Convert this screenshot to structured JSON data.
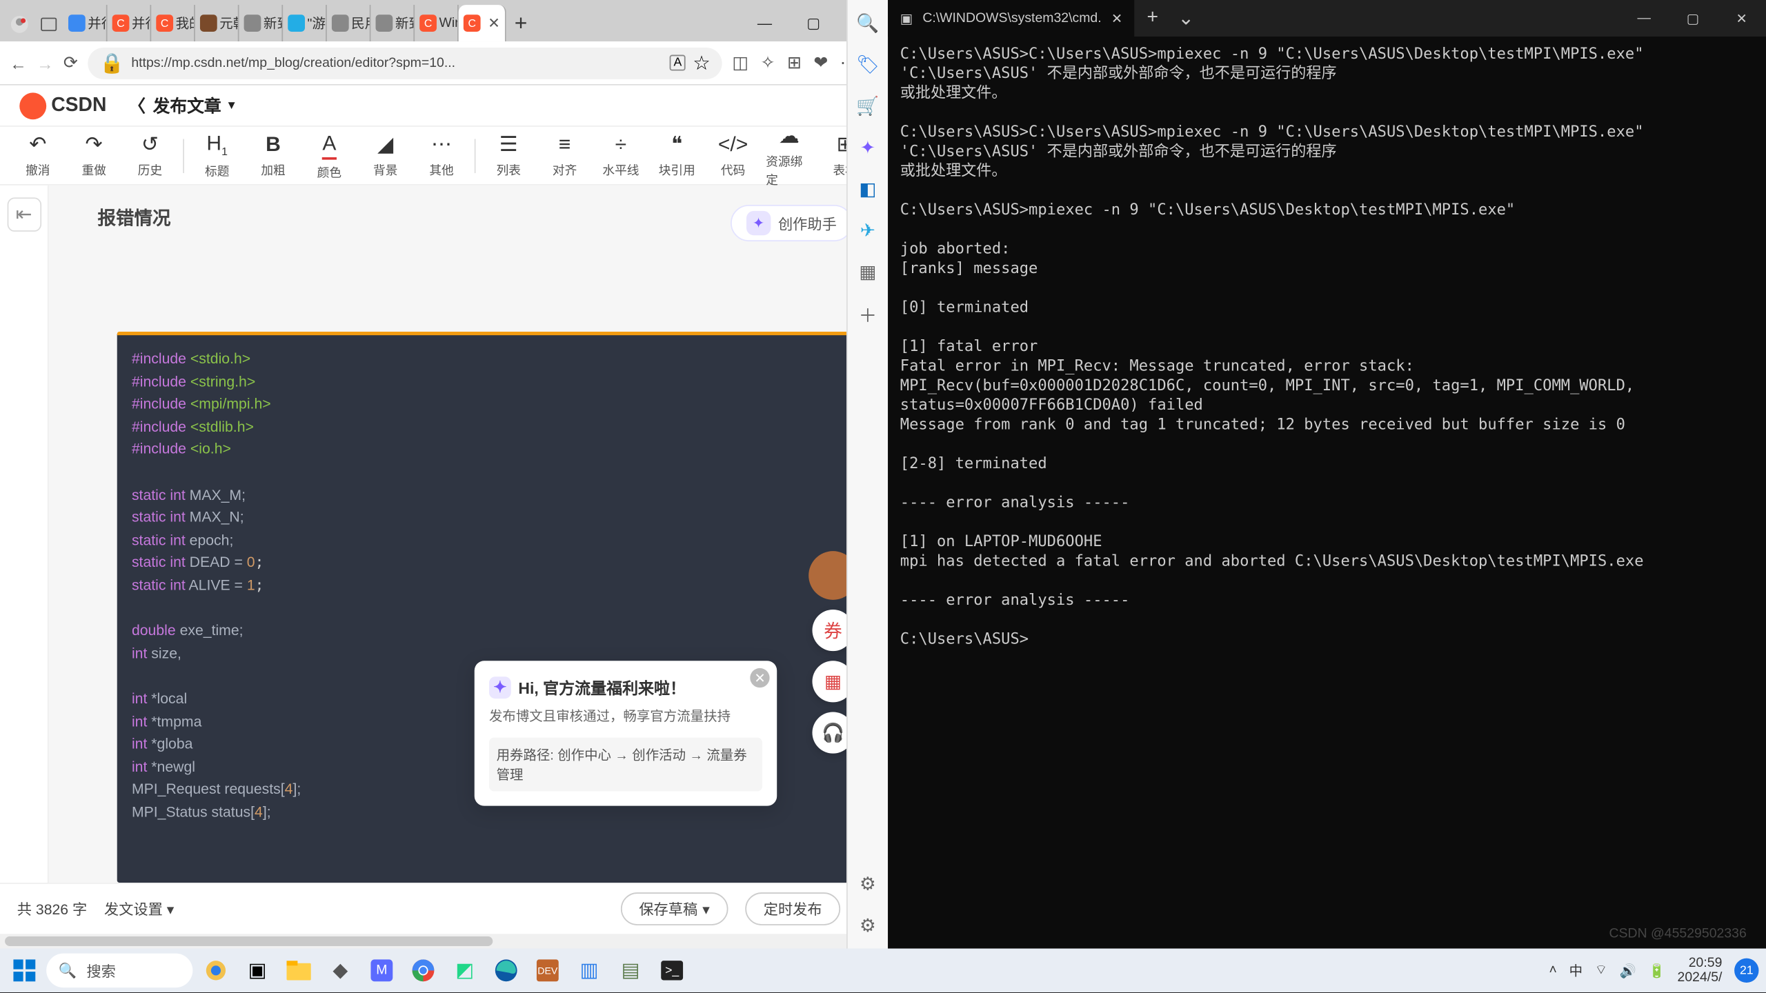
{
  "browser": {
    "tabs": [
      {
        "icon": "q",
        "label": "并行"
      },
      {
        "icon": "c",
        "label": "并行"
      },
      {
        "icon": "c",
        "label": "我的"
      },
      {
        "icon": "bear",
        "label": "元朝"
      },
      {
        "icon": "page",
        "label": "新到"
      },
      {
        "icon": "bili",
        "label": "\"游"
      },
      {
        "icon": "page",
        "label": "民用"
      },
      {
        "icon": "page",
        "label": "新到"
      },
      {
        "icon": "c",
        "label": "Wir"
      },
      {
        "icon": "c",
        "label": "",
        "active": true
      }
    ],
    "addr": "https://mp.csdn.net/mp_blog/creation/editor?spm=10...",
    "addr_tech": "A",
    "csdn": {
      "logo": "CSDN",
      "title": "发布文章"
    },
    "toolbar": {
      "undo": "撤消",
      "redo": "重做",
      "history": "历史",
      "h": "标题",
      "b": "加粗",
      "color": "颜色",
      "bg": "背景",
      "other": "其他",
      "list": "列表",
      "align": "对齐",
      "hr": "水平线",
      "quote": "块引用",
      "code": "代码",
      "res": "资源绑定",
      "table": "表格"
    },
    "section_heading": "报错情况",
    "assist": "创作助手",
    "popup": {
      "title": "Hi, 官方流量福利来啦！",
      "sub": "发布博文且审核通过，畅享官方流量扶持",
      "path_label": "用券路径:",
      "p1": "创作中心",
      "p2": "创作活动",
      "p3": "流量券管理"
    },
    "footer": {
      "count_prefix": "共",
      "count": "3826",
      "count_suffix": "字",
      "settings": "发文设置",
      "draft": "保存草稿",
      "schedule": "定时发布"
    },
    "code_lines": [
      {
        "t": "inc",
        "h": "#include ",
        "v": "<stdio.h>"
      },
      {
        "t": "inc",
        "h": "#include ",
        "v": "<string.h>"
      },
      {
        "t": "inc",
        "h": "#include ",
        "v": "<mpi/mpi.h>"
      },
      {
        "t": "inc",
        "h": "#include ",
        "v": "<stdlib.h>"
      },
      {
        "t": "inc",
        "h": "#include ",
        "v": "<io.h>"
      },
      {
        "t": "blank"
      },
      {
        "t": "decl",
        "k": "static int",
        "n": " MAX_M;"
      },
      {
        "t": "decl",
        "k": "static int",
        "n": " MAX_N;"
      },
      {
        "t": "decl",
        "k": "static int",
        "n": " epoch;"
      },
      {
        "t": "decl",
        "k": "static int",
        "n": " DEAD = ",
        "num": "0",
        "tail": ";"
      },
      {
        "t": "decl",
        "k": "static int",
        "n": " ALIVE = ",
        "num": "1",
        "tail": ";"
      },
      {
        "t": "blank"
      },
      {
        "t": "decl",
        "k": "double",
        "n": " exe_time;"
      },
      {
        "t": "decl",
        "k": "int",
        "n": " size,"
      },
      {
        "t": "blank"
      },
      {
        "t": "decl",
        "k": "int",
        "n": " *local"
      },
      {
        "t": "decl",
        "k": "int",
        "n": " *tmpma"
      },
      {
        "t": "decl",
        "k": "int",
        "n": " *globa"
      },
      {
        "t": "decl",
        "k": "int",
        "n": " *newgl"
      },
      {
        "t": "plain",
        "v": "MPI_Request requests[",
        "num": "4",
        "tail": "];"
      },
      {
        "t": "plain",
        "v": "MPI_Status status[",
        "num": "4",
        "tail": "];"
      }
    ]
  },
  "side_icons": [
    "search",
    "tag",
    "cart",
    "copilot",
    "outlook",
    "send",
    "grid",
    "plus",
    "tool",
    "gear"
  ],
  "terminal": {
    "title": "C:\\WINDOWS\\system32\\cmd.",
    "body": "C:\\Users\\ASUS>C:\\Users\\ASUS>mpiexec -n 9 \"C:\\Users\\ASUS\\Desktop\\testMPI\\MPIS.exe\"\n'C:\\Users\\ASUS' 不是内部或外部命令，也不是可运行的程序\n或批处理文件。\n\nC:\\Users\\ASUS>C:\\Users\\ASUS>mpiexec -n 9 \"C:\\Users\\ASUS\\Desktop\\testMPI\\MPIS.exe\"\n'C:\\Users\\ASUS' 不是内部或外部命令，也不是可运行的程序\n或批处理文件。\n\nC:\\Users\\ASUS>mpiexec -n 9 \"C:\\Users\\ASUS\\Desktop\\testMPI\\MPIS.exe\"\n\njob aborted:\n[ranks] message\n\n[0] terminated\n\n[1] fatal error\nFatal error in MPI_Recv: Message truncated, error stack:\nMPI_Recv(buf=0x000001D2028C1D6C, count=0, MPI_INT, src=0, tag=1, MPI_COMM_WORLD, status=0x00007FF66B1CD0A0) failed\nMessage from rank 0 and tag 1 truncated; 12 bytes received but buffer size is 0\n\n[2-8] terminated\n\n---- error analysis -----\n\n[1] on LAPTOP-MUD6OOHE\nmpi has detected a fatal error and aborted C:\\Users\\ASUS\\Desktop\\testMPI\\MPIS.exe\n\n---- error analysis -----\n\nC:\\Users\\ASUS>",
    "watermark": "CSDN @45529502336"
  },
  "taskbar": {
    "search": "搜索",
    "apps": [
      "copilot",
      "taskview",
      "explorer",
      "3d",
      "ms",
      "chrome",
      "py",
      "edge",
      "dev",
      "teams",
      "np",
      "term"
    ],
    "tray": {
      "ime": "中",
      "time": "20:59",
      "date": "2024/5/",
      "notif": "21"
    }
  }
}
